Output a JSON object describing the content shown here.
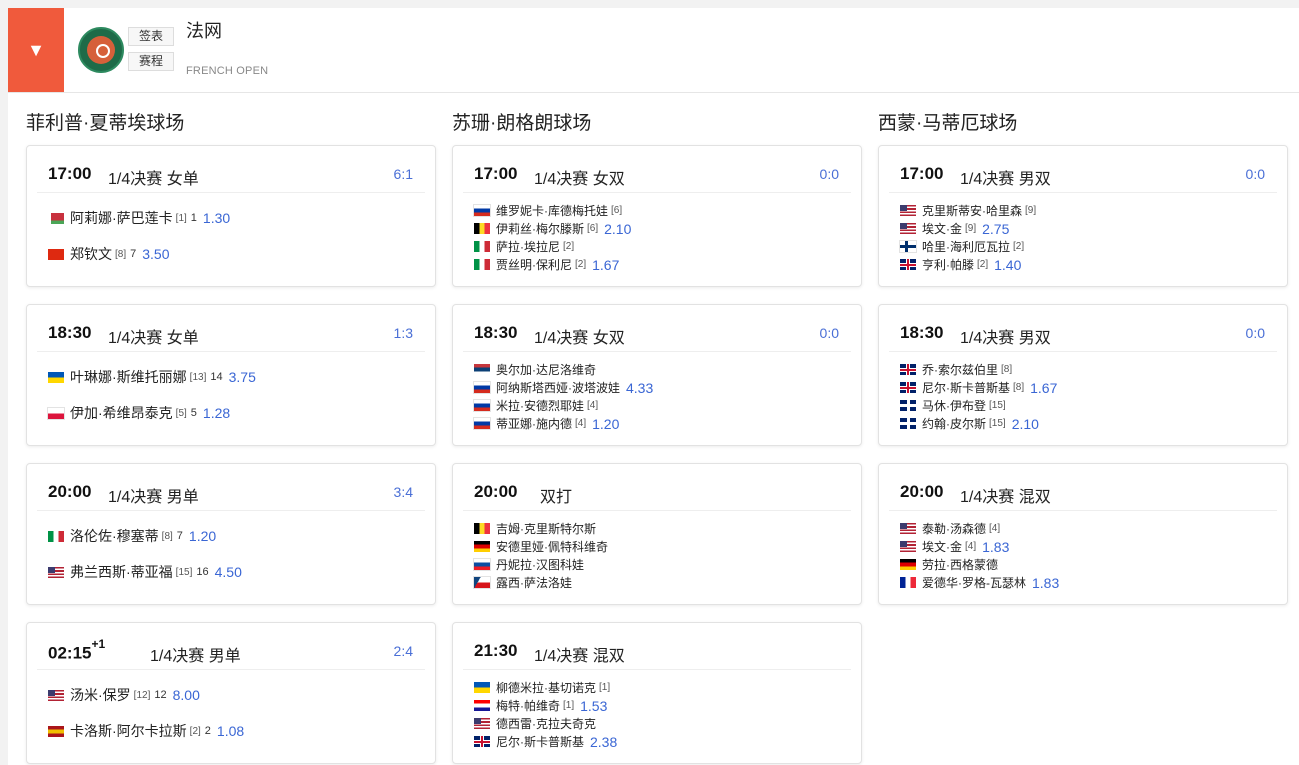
{
  "header": {
    "title": "法网",
    "subtitle": "FRENCH OPEN",
    "btn_draw": "签表",
    "btn_schedule": "赛程",
    "toggle_icon": "▼"
  },
  "courts": [
    {
      "name": "菲利普·夏蒂埃球场",
      "matches": [
        {
          "time": "17:00",
          "sup": "",
          "round": "1/4决赛 女单",
          "score": "6:1",
          "type": "singles",
          "players": [
            {
              "flag": "BY",
              "name": "阿莉娜·萨巴莲卡",
              "seed": "[1]",
              "num": "1",
              "odd": "1.30"
            },
            {
              "flag": "CN",
              "name": "郑钦文",
              "seed": "[8]",
              "num": "7",
              "odd": "3.50"
            }
          ]
        },
        {
          "time": "18:30",
          "sup": "",
          "round": "1/4决赛 女单",
          "score": "1:3",
          "type": "singles",
          "players": [
            {
              "flag": "UA",
              "name": "叶琳娜·斯维托丽娜",
              "seed": "[13]",
              "num": "14",
              "odd": "3.75"
            },
            {
              "flag": "PL",
              "name": "伊加·希维昂泰克",
              "seed": "[5]",
              "num": "5",
              "odd": "1.28"
            }
          ]
        },
        {
          "time": "20:00",
          "sup": "",
          "round": "1/4决赛 男单",
          "score": "3:4",
          "type": "singles",
          "players": [
            {
              "flag": "IT",
              "name": "洛伦佐·穆塞蒂",
              "seed": "[8]",
              "num": "7",
              "odd": "1.20"
            },
            {
              "flag": "US",
              "name": "弗兰西斯·蒂亚福",
              "seed": "[15]",
              "num": "16",
              "odd": "4.50"
            }
          ]
        },
        {
          "time": "02:15",
          "sup": "+1",
          "round": "1/4决赛 男单",
          "score": "2:4",
          "type": "singles",
          "players": [
            {
              "flag": "US",
              "name": "汤米·保罗",
              "seed": "[12]",
              "num": "12",
              "odd": "8.00"
            },
            {
              "flag": "ES",
              "name": "卡洛斯·阿尔卡拉斯",
              "seed": "[2]",
              "num": "2",
              "odd": "1.08"
            }
          ]
        }
      ]
    },
    {
      "name": "苏珊·朗格朗球场",
      "matches": [
        {
          "time": "17:00",
          "sup": "",
          "round": "1/4决赛 女双",
          "score": "0:0",
          "type": "doubles",
          "players": [
            {
              "flag": "RU",
              "name": "维罗妮卡·库德梅托娃",
              "seed": "[6]",
              "num": "",
              "odd": ""
            },
            {
              "flag": "BE",
              "name": "伊莉丝·梅尔滕斯",
              "seed": "[6]",
              "num": "",
              "odd": "2.10"
            },
            {
              "flag": "IT",
              "name": "萨拉·埃拉尼",
              "seed": "[2]",
              "num": "",
              "odd": ""
            },
            {
              "flag": "IT",
              "name": "贾丝明·保利尼",
              "seed": "[2]",
              "num": "",
              "odd": "1.67"
            }
          ]
        },
        {
          "time": "18:30",
          "sup": "",
          "round": "1/4决赛 女双",
          "score": "0:0",
          "type": "doubles",
          "players": [
            {
              "flag": "RS",
              "name": "奥尔加·达尼洛维奇",
              "seed": "",
              "num": "",
              "odd": ""
            },
            {
              "flag": "RU",
              "name": "阿纳斯塔西娅·波塔波娃",
              "seed": "",
              "num": "",
              "odd": "4.33"
            },
            {
              "flag": "RU",
              "name": "米拉·安德烈耶娃",
              "seed": "[4]",
              "num": "",
              "odd": ""
            },
            {
              "flag": "RU",
              "name": "蒂亚娜·施内德",
              "seed": "[4]",
              "num": "",
              "odd": "1.20"
            }
          ]
        },
        {
          "time": "20:00",
          "sup": "",
          "round": "双打",
          "score": "",
          "type": "doubles",
          "players": [
            {
              "flag": "BE",
              "name": "吉姆·克里斯特尔斯",
              "seed": "",
              "num": "",
              "odd": ""
            },
            {
              "flag": "DE",
              "name": "安德里娅·佩特科维奇",
              "seed": "",
              "num": "",
              "odd": ""
            },
            {
              "flag": "SK",
              "name": "丹妮拉·汉图科娃",
              "seed": "",
              "num": "",
              "odd": ""
            },
            {
              "flag": "CZ",
              "name": "露西·萨法洛娃",
              "seed": "",
              "num": "",
              "odd": ""
            }
          ]
        },
        {
          "time": "21:30",
          "sup": "",
          "round": "1/4决赛 混双",
          "score": "",
          "type": "doubles",
          "players": [
            {
              "flag": "UA",
              "name": "柳德米拉·基切诺克",
              "seed": "[1]",
              "num": "",
              "odd": ""
            },
            {
              "flag": "HR",
              "name": "梅特·帕维奇",
              "seed": "[1]",
              "num": "",
              "odd": "1.53"
            },
            {
              "flag": "US",
              "name": "德西雷·克拉夫奇克",
              "seed": "",
              "num": "",
              "odd": ""
            },
            {
              "flag": "GB",
              "name": "尼尔·斯卡普斯基",
              "seed": "",
              "num": "",
              "odd": "2.38"
            }
          ]
        }
      ]
    },
    {
      "name": "西蒙·马蒂厄球场",
      "matches": [
        {
          "time": "17:00",
          "sup": "",
          "round": "1/4决赛 男双",
          "score": "0:0",
          "type": "doubles",
          "players": [
            {
              "flag": "US",
              "name": "克里斯蒂安·哈里森",
              "seed": "[9]",
              "num": "",
              "odd": ""
            },
            {
              "flag": "US",
              "name": "埃文·金",
              "seed": "[9]",
              "num": "",
              "odd": "2.75"
            },
            {
              "flag": "FI",
              "name": "哈里·海利厄瓦拉",
              "seed": "[2]",
              "num": "",
              "odd": ""
            },
            {
              "flag": "GB",
              "name": "亨利·帕滕",
              "seed": "[2]",
              "num": "",
              "odd": "1.40"
            }
          ]
        },
        {
          "time": "18:30",
          "sup": "",
          "round": "1/4决赛 男双",
          "score": "0:0",
          "type": "doubles",
          "players": [
            {
              "flag": "GB",
              "name": "乔·索尔兹伯里",
              "seed": "[8]",
              "num": "",
              "odd": ""
            },
            {
              "flag": "GB",
              "name": "尼尔·斯卡普斯基",
              "seed": "[8]",
              "num": "",
              "odd": "1.67"
            },
            {
              "flag": "AU",
              "name": "马休·伊布登",
              "seed": "[15]",
              "num": "",
              "odd": ""
            },
            {
              "flag": "AU",
              "name": "约翰·皮尔斯",
              "seed": "[15]",
              "num": "",
              "odd": "2.10"
            }
          ]
        },
        {
          "time": "20:00",
          "sup": "",
          "round": "1/4决赛 混双",
          "score": "",
          "type": "doubles",
          "players": [
            {
              "flag": "US",
              "name": "泰勒·汤森德",
              "seed": "[4]",
              "num": "",
              "odd": ""
            },
            {
              "flag": "US",
              "name": "埃文·金",
              "seed": "[4]",
              "num": "",
              "odd": "1.83"
            },
            {
              "flag": "DE",
              "name": "劳拉·西格蒙德",
              "seed": "",
              "num": "",
              "odd": ""
            },
            {
              "flag": "FR",
              "name": "爱德华·罗格-瓦瑟林",
              "seed": "",
              "num": "",
              "odd": "1.83"
            }
          ]
        }
      ]
    }
  ],
  "flag_colors": {
    "BY": [
      "#c8313e",
      "#c8313e",
      "#4aa657"
    ],
    "CN": [
      "#de2910",
      "#de2910",
      "#de2910"
    ],
    "UA": [
      "#0057b7",
      "#ffd700"
    ],
    "PL": [
      "#ffffff",
      "#dc143c"
    ],
    "IT": [
      "#009246",
      "#ffffff",
      "#ce2b37"
    ],
    "US": [
      "#b22234",
      "#ffffff",
      "#3c3b6e"
    ],
    "ES": [
      "#aa151b",
      "#f1bf00",
      "#aa151b"
    ],
    "RU": [
      "#ffffff",
      "#0039a6",
      "#d52b1e"
    ],
    "BE": [
      "#000000",
      "#fdda24",
      "#ef3340"
    ],
    "RS": [
      "#c6363c",
      "#0c4076",
      "#ffffff"
    ],
    "DE": [
      "#000000",
      "#dd0000",
      "#ffce00"
    ],
    "SK": [
      "#ffffff",
      "#0b4ea2",
      "#ee1c25"
    ],
    "CZ": [
      "#ffffff",
      "#d7141a"
    ],
    "HR": [
      "#ff0000",
      "#ffffff",
      "#171796"
    ],
    "GB": [
      "#012169",
      "#ffffff",
      "#c8102e"
    ],
    "FI": [
      "#ffffff",
      "#002f6c"
    ],
    "AU": [
      "#012169",
      "#ffffff"
    ],
    "FR": [
      "#002395",
      "#ffffff",
      "#ed2939"
    ]
  }
}
